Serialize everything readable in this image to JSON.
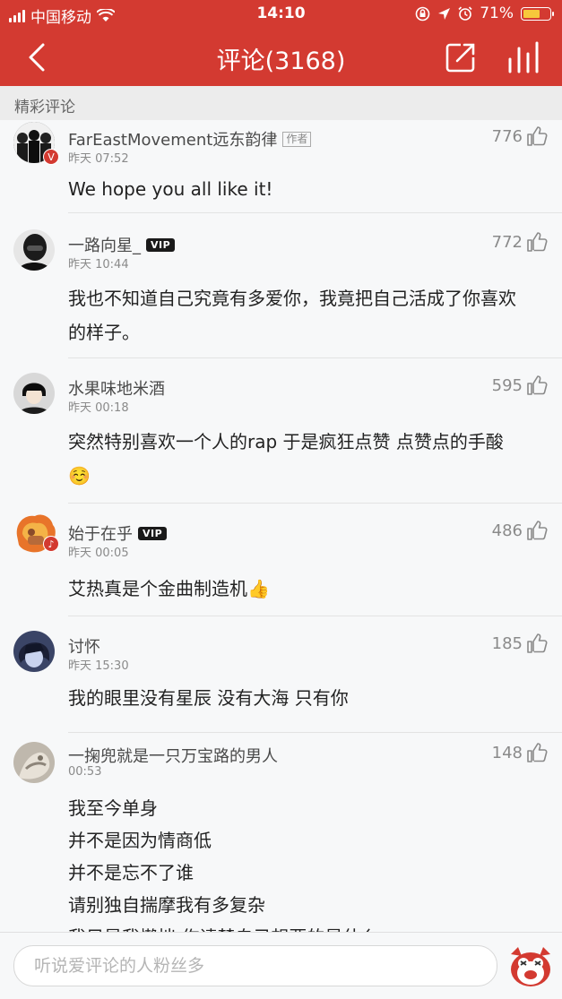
{
  "status_bar": {
    "carrier": "中国移动",
    "time": "14:10",
    "battery": "71%",
    "battery_level": 0.71
  },
  "nav": {
    "title": "评论(3168)",
    "back_icon": "chevron-left-icon",
    "share_icon": "share-icon",
    "chart_icon": "bar-chart-icon"
  },
  "section": {
    "label": "精彩评论"
  },
  "comments": [
    {
      "username": "FarEastMovement远东韵律",
      "tag": "作者",
      "time": "昨天 07:52",
      "likes": "776",
      "lines": [
        "We hope you all like it!"
      ]
    },
    {
      "username": "一路向星_",
      "vip": "VIP",
      "time": "昨天 10:44",
      "likes": "772",
      "lines": [
        "我也不知道自己究竟有多爱你，我竟把自己活成了你喜欢",
        "的样子。"
      ]
    },
    {
      "username": "水果味地米酒",
      "time": "昨天 00:18",
      "likes": "595",
      "lines": [
        "突然特别喜欢一个人的rap 于是疯狂点赞 点赞点的手酸",
        "☺️"
      ]
    },
    {
      "username": "始于在乎",
      "vip": "VIP",
      "time": "昨天 00:05",
      "likes": "486",
      "lines": [
        "艾热真是个金曲制造机👍"
      ]
    },
    {
      "username": "讨怀",
      "time": "昨天 15:30",
      "likes": "185",
      "lines": [
        "我的眼里没有星辰 没有大海 只有你"
      ]
    },
    {
      "username": "一掬兜就是一只万宝路的男人",
      "time": "00:53",
      "likes": "148",
      "lines": [
        "我至今单身",
        "并不是因为情商低",
        "并不是忘不了谁",
        "请别独自揣摩我有多复杂",
        "我只是我懒拙·作请楚自己想要的是什么"
      ]
    }
  ],
  "composer": {
    "placeholder": "听说爱评论的人粉丝多"
  },
  "colors": {
    "brand_red": "#d33a31",
    "vip_black": "#1a1a1a"
  }
}
